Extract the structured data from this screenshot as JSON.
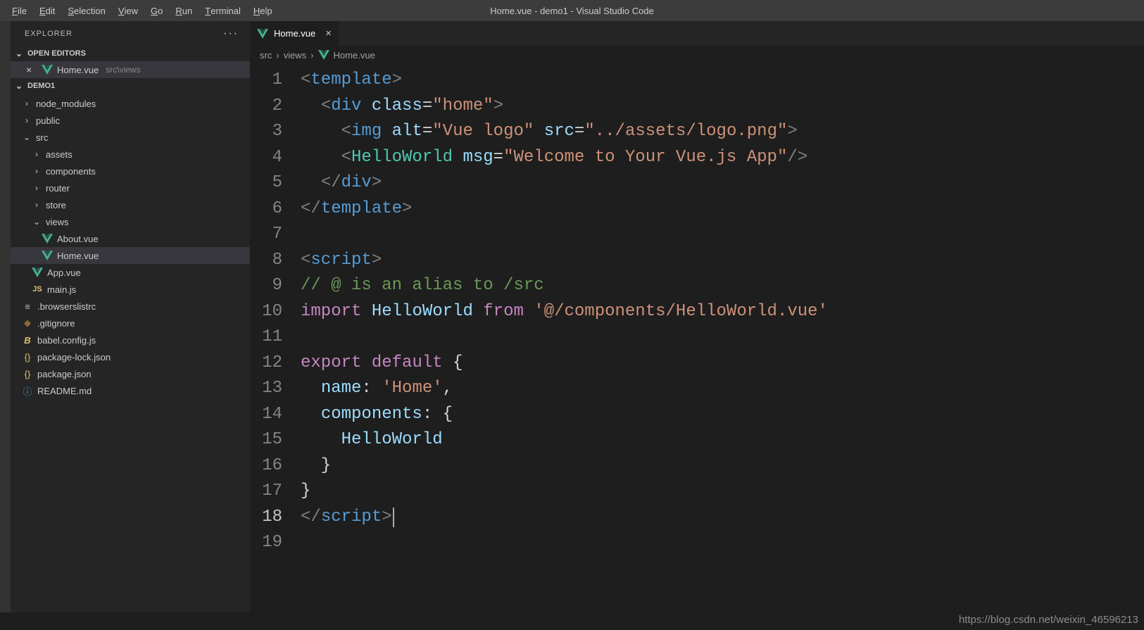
{
  "title": "Home.vue - demo1 - Visual Studio Code",
  "menu": {
    "items": [
      "File",
      "Edit",
      "Selection",
      "View",
      "Go",
      "Run",
      "Terminal",
      "Help"
    ]
  },
  "sidebar": {
    "header": "EXPLORER",
    "openEditors": {
      "label": "OPEN EDITORS",
      "items": [
        {
          "name": "Home.vue",
          "path": "src\\views"
        }
      ]
    },
    "project": {
      "label": "DEMO1",
      "tree": [
        {
          "indent": 0,
          "type": "folder-closed",
          "label": "node_modules"
        },
        {
          "indent": 0,
          "type": "folder-closed",
          "label": "public"
        },
        {
          "indent": 0,
          "type": "folder-open",
          "label": "src"
        },
        {
          "indent": 1,
          "type": "folder-closed",
          "label": "assets"
        },
        {
          "indent": 1,
          "type": "folder-closed",
          "label": "components"
        },
        {
          "indent": 1,
          "type": "folder-closed",
          "label": "router"
        },
        {
          "indent": 1,
          "type": "folder-closed",
          "label": "store"
        },
        {
          "indent": 1,
          "type": "folder-open",
          "label": "views"
        },
        {
          "indent": 2,
          "type": "vue",
          "label": "About.vue"
        },
        {
          "indent": 2,
          "type": "vue",
          "label": "Home.vue",
          "selected": true
        },
        {
          "indent": 1,
          "type": "vue",
          "label": "App.vue"
        },
        {
          "indent": 1,
          "type": "js",
          "label": "main.js"
        },
        {
          "indent": 0,
          "type": "cfg",
          "label": ".browserslistrc"
        },
        {
          "indent": 0,
          "type": "git",
          "label": ".gitignore"
        },
        {
          "indent": 0,
          "type": "babel",
          "label": "babel.config.js"
        },
        {
          "indent": 0,
          "type": "json",
          "label": "package-lock.json"
        },
        {
          "indent": 0,
          "type": "json",
          "label": "package.json"
        },
        {
          "indent": 0,
          "type": "info",
          "label": "README.md"
        }
      ]
    }
  },
  "tabs": [
    {
      "name": "Home.vue"
    }
  ],
  "breadcrumbs": [
    "src",
    "views",
    "Home.vue"
  ],
  "editor": {
    "lineCount": 19,
    "currentLine": 18,
    "lines": [
      {
        "segs": [
          [
            "<",
            "t-gray"
          ],
          [
            "template",
            "t-tag"
          ],
          [
            ">",
            "t-gray"
          ]
        ]
      },
      {
        "segs": [
          [
            "  ",
            "t-plain"
          ],
          [
            "<",
            "t-gray"
          ],
          [
            "div",
            "t-tag"
          ],
          [
            " ",
            "t-plain"
          ],
          [
            "class",
            "t-attr"
          ],
          [
            "=",
            "t-plain"
          ],
          [
            "\"home\"",
            "t-str"
          ],
          [
            ">",
            "t-gray"
          ]
        ]
      },
      {
        "segs": [
          [
            "    ",
            "t-plain"
          ],
          [
            "<",
            "t-gray"
          ],
          [
            "img",
            "t-tag"
          ],
          [
            " ",
            "t-plain"
          ],
          [
            "alt",
            "t-attr"
          ],
          [
            "=",
            "t-plain"
          ],
          [
            "\"Vue logo\"",
            "t-str"
          ],
          [
            " ",
            "t-plain"
          ],
          [
            "src",
            "t-attr"
          ],
          [
            "=",
            "t-plain"
          ],
          [
            "\"../assets/logo.png\"",
            "t-str"
          ],
          [
            ">",
            "t-gray"
          ]
        ]
      },
      {
        "segs": [
          [
            "    ",
            "t-plain"
          ],
          [
            "<",
            "t-gray"
          ],
          [
            "HelloWorld",
            "t-comp"
          ],
          [
            " ",
            "t-plain"
          ],
          [
            "msg",
            "t-attr"
          ],
          [
            "=",
            "t-plain"
          ],
          [
            "\"Welcome to Your Vue.js App\"",
            "t-str"
          ],
          [
            "/>",
            "t-gray"
          ]
        ]
      },
      {
        "segs": [
          [
            "  ",
            "t-plain"
          ],
          [
            "</",
            "t-gray"
          ],
          [
            "div",
            "t-tag"
          ],
          [
            ">",
            "t-gray"
          ]
        ]
      },
      {
        "segs": [
          [
            "</",
            "t-gray"
          ],
          [
            "template",
            "t-tag"
          ],
          [
            ">",
            "t-gray"
          ]
        ]
      },
      {
        "segs": [
          [
            "",
            "t-plain"
          ]
        ]
      },
      {
        "segs": [
          [
            "<",
            "t-gray"
          ],
          [
            "script",
            "t-tag"
          ],
          [
            ">",
            "t-gray"
          ]
        ]
      },
      {
        "segs": [
          [
            "// @ is an alias to /src",
            "t-cmnt"
          ]
        ]
      },
      {
        "segs": [
          [
            "import",
            "t-key"
          ],
          [
            " ",
            "t-plain"
          ],
          [
            "HelloWorld",
            "t-attr"
          ],
          [
            " ",
            "t-plain"
          ],
          [
            "from",
            "t-key"
          ],
          [
            " ",
            "t-plain"
          ],
          [
            "'@/components/HelloWorld.vue'",
            "t-str"
          ]
        ]
      },
      {
        "segs": [
          [
            "",
            "t-plain"
          ]
        ]
      },
      {
        "segs": [
          [
            "export",
            "t-key"
          ],
          [
            " ",
            "t-plain"
          ],
          [
            "default",
            "t-key"
          ],
          [
            " {",
            "t-plain"
          ]
        ]
      },
      {
        "segs": [
          [
            "  ",
            "t-plain"
          ],
          [
            "name",
            "t-attr"
          ],
          [
            ": ",
            "t-plain"
          ],
          [
            "'Home'",
            "t-str"
          ],
          [
            ",",
            "t-plain"
          ]
        ]
      },
      {
        "segs": [
          [
            "  ",
            "t-plain"
          ],
          [
            "components",
            "t-attr"
          ],
          [
            ": {",
            "t-plain"
          ]
        ]
      },
      {
        "segs": [
          [
            "    ",
            "t-plain"
          ],
          [
            "HelloWorld",
            "t-attr"
          ]
        ]
      },
      {
        "segs": [
          [
            "  }",
            "t-plain"
          ]
        ]
      },
      {
        "segs": [
          [
            "}",
            "t-plain"
          ]
        ]
      },
      {
        "segs": [
          [
            "</",
            "t-gray"
          ],
          [
            "script",
            "t-tag"
          ],
          [
            ">",
            "t-gray"
          ]
        ],
        "cursor": true
      },
      {
        "segs": [
          [
            "",
            "t-plain"
          ]
        ]
      }
    ]
  },
  "watermark": "https://blog.csdn.net/weixin_46596213"
}
